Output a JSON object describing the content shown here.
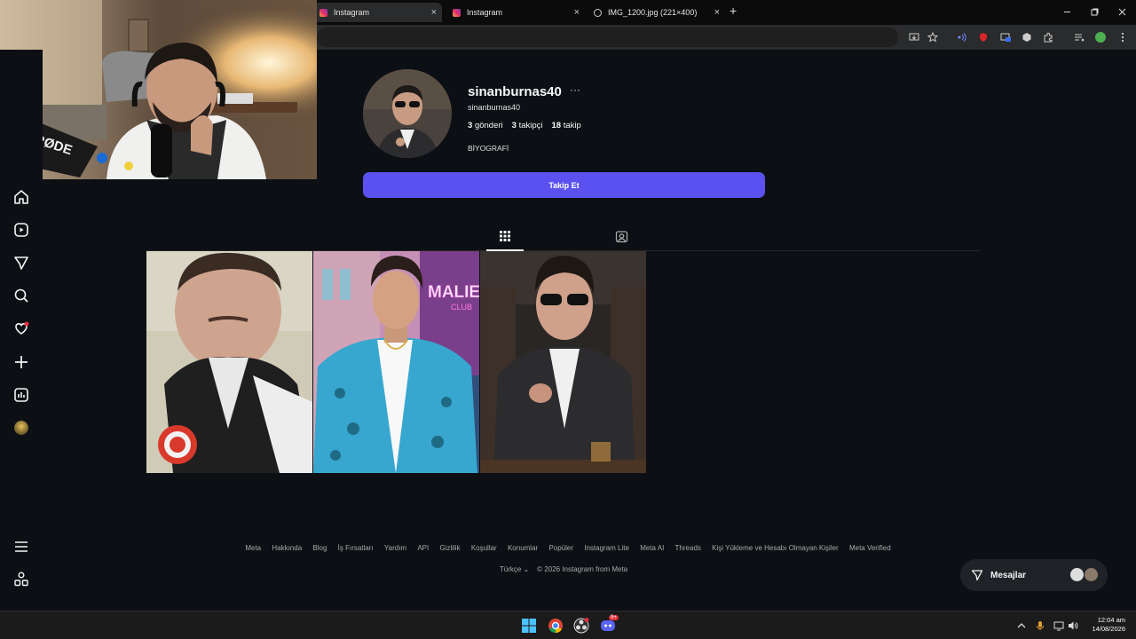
{
  "browser": {
    "tabs": [
      {
        "label": "Instagram"
      },
      {
        "label": "Instagram"
      },
      {
        "label": "IMG_1200.jpg (221×400)"
      }
    ],
    "close_glyph": "×",
    "new_tab_glyph": "+"
  },
  "webcam": {
    "mic_brand": "RØDE"
  },
  "sidebar": {
    "icons": [
      "home-icon",
      "reels-icon",
      "explore-icon",
      "search-icon",
      "notifications-icon",
      "create-icon",
      "dashboard-icon",
      "profile-avatar-icon",
      "menu-icon",
      "more-apps-icon"
    ],
    "notification_dot_color": "#ff3040"
  },
  "profile": {
    "username": "sinanburnas40",
    "more_glyph": "···",
    "handle": "sinanburnas40",
    "posts_count": "3",
    "posts_label": "gönderi",
    "followers_count": "3",
    "followers_label": "takipçi",
    "following_count": "18",
    "following_label": "takip",
    "bio": "BİYOGRAFİ",
    "follow_button": "Takip Et",
    "follow_button_color": "#5b51f0"
  },
  "content_tabs": [
    "grid-icon",
    "tagged-icon"
  ],
  "posts": [
    {
      "description": "selfie"
    },
    {
      "description": "gta-style illustration",
      "sign_text": "MALIE",
      "sign_sub": "CLUB"
    },
    {
      "description": "suit portrait"
    }
  ],
  "footer": {
    "links": [
      "Meta",
      "Hakkında",
      "Blog",
      "İş Fırsatları",
      "Yardım",
      "API",
      "Gizlilik",
      "Koşullar",
      "Konumlar",
      "Popüler",
      "Instagram Lite",
      "Meta AI",
      "Threads",
      "Kişi Yükleme ve Hesabı Olmayan Kişiler",
      "Meta Verified"
    ],
    "language": "Türkçe",
    "copyright": "© 2026 Instagram from Meta"
  },
  "messages": {
    "label": "Mesajlar"
  },
  "taskbar": {
    "time": "12:04 am",
    "date": "14/08/2026",
    "badge": "9+"
  }
}
